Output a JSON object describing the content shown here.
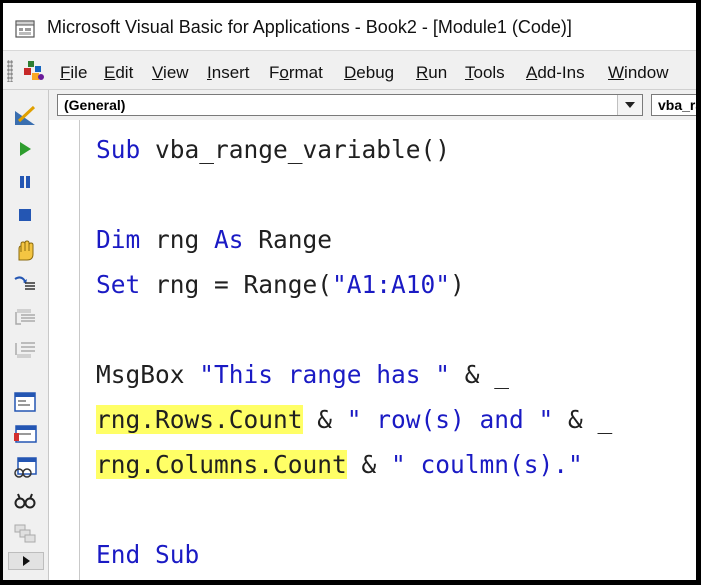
{
  "window": {
    "title": "Microsoft Visual Basic for Applications - Book2 - [Module1 (Code)]"
  },
  "menu": [
    {
      "key": "F",
      "rest": "ile"
    },
    {
      "key": "E",
      "rest": "dit"
    },
    {
      "key": "V",
      "rest": "iew"
    },
    {
      "key": "I",
      "rest": "nsert"
    },
    {
      "prefix": "F",
      "key": "o",
      "rest": "rmat"
    },
    {
      "key": "D",
      "rest": "ebug"
    },
    {
      "key": "R",
      "rest": "un"
    },
    {
      "key": "T",
      "rest": "ools"
    },
    {
      "key": "A",
      "rest": "dd-Ins"
    },
    {
      "key": "W",
      "rest": "indow"
    }
  ],
  "toolbar_icons": [
    "design-mode-icon",
    "run-icon",
    "break-icon",
    "reset-icon",
    "toggle-breakpoint-icon",
    "step-into-icon",
    "step-over-icon",
    "step-out-icon",
    "locals-window-icon",
    "immediate-window-icon",
    "watch-window-icon",
    "quick-watch-icon",
    "call-stack-icon",
    "scroll-right-icon"
  ],
  "code_header": {
    "object_combo": "(General)",
    "procedure_combo": "vba_range_variable"
  },
  "code": {
    "line1": {
      "kw1": "Sub",
      "name": " vba_range_variable()"
    },
    "line3": {
      "kw1": "Dim",
      "id1": " rng ",
      "kw2": "As",
      "id2": " Range"
    },
    "line4": {
      "kw1": "Set",
      "id1": " rng = Range(",
      "str1": "\"A1:A10\"",
      "id2": ")"
    },
    "line6": {
      "id1": "MsgBox ",
      "str1": "\"This range has \"",
      "id2": " & _"
    },
    "line7": {
      "hl": "rng.Rows.Count",
      "id1": " & ",
      "str1": "\" row(s) and \"",
      "id2": " & _"
    },
    "line8": {
      "hl": "rng.Columns.Count",
      "id1": " & ",
      "str1": "\" coulmn(s).\""
    },
    "line10": {
      "kw1": "End",
      "kw2": " Sub"
    }
  },
  "colors": {
    "keyword": "#1a1ac4",
    "identifier": "#202020",
    "highlight": "#ffff66"
  }
}
